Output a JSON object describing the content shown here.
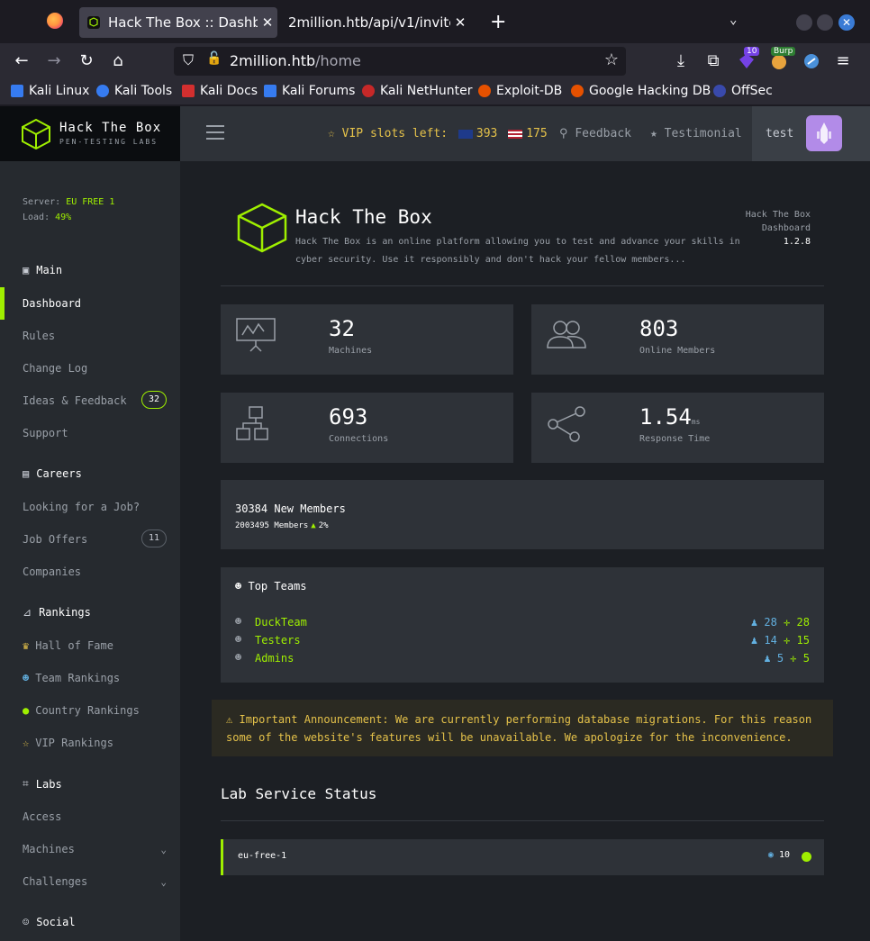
{
  "browser": {
    "tabs": [
      {
        "label": "Hack The Box :: Dashboard"
      },
      {
        "label": "2million.htb/api/v1/invite/generate"
      }
    ],
    "url_host": "2million.htb",
    "url_path": "/home",
    "extension_badge": "10",
    "burp_badge": "Burp",
    "bookmarks": [
      "Kali Linux",
      "Kali Tools",
      "Kali Docs",
      "Kali Forums",
      "Kali NetHunter",
      "Exploit-DB",
      "Google Hacking DB",
      "OffSec"
    ]
  },
  "site": {
    "logo_title": "Hack The Box",
    "logo_subtitle": "PEN-TESTING LABS",
    "vip_label": "VIP slots left:",
    "vip_eu": "393",
    "vip_us": "175",
    "feedback": "Feedback",
    "testimonial": "Testimonial",
    "username": "test"
  },
  "sidebar": {
    "server_label": "Server:",
    "server_value": "EU FREE 1",
    "load_label": "Load:",
    "load_value": "49%",
    "main_heading": "Main",
    "main_items": [
      "Dashboard",
      "Rules",
      "Change Log",
      "Ideas & Feedback",
      "Support"
    ],
    "ideas_badge": "32",
    "careers_heading": "Careers",
    "careers_items": [
      "Looking for a Job?",
      "Job Offers",
      "Companies"
    ],
    "job_offers_badge": "11",
    "rankings_heading": "Rankings",
    "rankings_items": [
      "Hall of Fame",
      "Team Rankings",
      "Country Rankings",
      "VIP Rankings"
    ],
    "labs_heading": "Labs",
    "labs_items": [
      "Access",
      "Machines",
      "Challenges"
    ],
    "social_heading": "Social"
  },
  "main": {
    "title": "Hack The Box",
    "description": "Hack The Box is an online platform allowing you to test and advance your skills in cyber security. Use it responsibly and don't hack your fellow members...",
    "meta_line1": "Hack The Box",
    "meta_line2": "Dashboard",
    "version": "1.2.8",
    "stats": [
      {
        "value": "32",
        "unit": "",
        "label": "Machines"
      },
      {
        "value": "803",
        "unit": "",
        "label": "Online Members"
      },
      {
        "value": "693",
        "unit": "",
        "label": "Connections"
      },
      {
        "value": "1.54",
        "unit": "ms",
        "label": "Response Time"
      }
    ],
    "new_members": "30384 New Members",
    "members_total": "2003495 Members",
    "members_growth": "2%",
    "top_teams_title": "Top Teams",
    "teams": [
      {
        "name": "DuckTeam",
        "members": "28",
        "points": "28"
      },
      {
        "name": "Testers",
        "members": "14",
        "points": "15"
      },
      {
        "name": "Admins",
        "members": "5",
        "points": "5"
      }
    ],
    "announcement": "Important Announcement: We are currently performing database migrations. For this reason some of the website's features will be unavailable. We apologize for the inconvenience.",
    "lab_status_title": "Lab Service Status",
    "lab": {
      "name": "eu-free-1",
      "users": "10"
    }
  },
  "colors": {
    "accent": "#9fef00",
    "warning": "#e5c24a",
    "info": "#62b0e0"
  }
}
